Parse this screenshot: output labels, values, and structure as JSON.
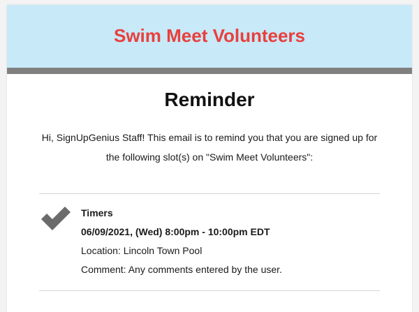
{
  "header": {
    "title": "Swim Meet Volunteers",
    "background_color": "#c8e9f8",
    "title_color": "#e8403d",
    "bar_color": "#808080"
  },
  "main": {
    "heading": "Reminder",
    "intro": "Hi, SignUpGenius Staff! This email is to remind you that you are signed up for the following slot(s) on \"Swim Meet Volunteers\":"
  },
  "slot": {
    "icon": "checkmark-icon",
    "title": "Timers",
    "datetime": "06/09/2021, (Wed) 8:00pm - 10:00pm EDT",
    "location": "Location: Lincoln Town Pool",
    "comment": "Comment: Any comments entered by the user."
  }
}
